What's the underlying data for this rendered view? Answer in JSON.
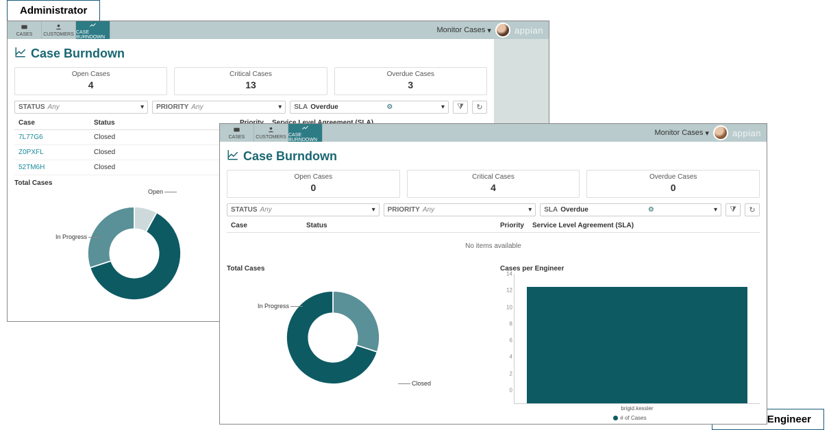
{
  "roles": {
    "admin": "Administrator",
    "engineer": "Support Engineer"
  },
  "nav": {
    "cases": "CASES",
    "customers": "CUSTOMERS",
    "burndown": "CASE BURNDOWN",
    "monitor": "Monitor Cases",
    "logo": "appian"
  },
  "admin": {
    "page_title": "Case Burndown",
    "stats": [
      {
        "label": "Open Cases",
        "value": "4"
      },
      {
        "label": "Critical Cases",
        "value": "13"
      },
      {
        "label": "Overdue Cases",
        "value": "3"
      }
    ],
    "filters": {
      "status_label": "STATUS",
      "status_value": "Any",
      "priority_label": "PRIORITY",
      "priority_value": "Any",
      "sla_label": "SLA",
      "sla_value": "Overdue"
    },
    "grid": {
      "cols": [
        "Case",
        "Status",
        "Priority",
        "Service Level Agreement (SLA)"
      ],
      "rows": [
        {
          "case": "7L77G6",
          "status": "Closed"
        },
        {
          "case": "Z0PXFL",
          "status": "Closed"
        },
        {
          "case": "52TM6H",
          "status": "Closed"
        }
      ]
    },
    "chart_title": "Total Cases",
    "seg_labels": {
      "open": "Open",
      "inprog": "In Progress"
    }
  },
  "eng": {
    "page_title": "Case Burndown",
    "stats": [
      {
        "label": "Open Cases",
        "value": "0"
      },
      {
        "label": "Critical Cases",
        "value": "4"
      },
      {
        "label": "Overdue Cases",
        "value": "0"
      }
    ],
    "filters": {
      "status_label": "STATUS",
      "status_value": "Any",
      "priority_label": "PRIORITY",
      "priority_value": "Any",
      "sla_label": "SLA",
      "sla_value": "Overdue"
    },
    "grid": {
      "cols": [
        "Case",
        "Status",
        "Priority",
        "Service Level Agreement (SLA)"
      ],
      "no_items": "No items available"
    },
    "chart_title": "Total Cases",
    "seg_labels": {
      "inprog": "In Progress",
      "closed": "Closed"
    },
    "bar_title": "Cases per Engineer",
    "bar_xlabel": "brigid.kessler",
    "bar_legend": "# of Cases"
  },
  "chart_data": [
    {
      "type": "pie",
      "title": "Total Cases (Administrator)",
      "slices": [
        {
          "name": "Open",
          "value": 8,
          "color": "#cdd9da"
        },
        {
          "name": "Closed",
          "value": 62,
          "color": "#0d5a63"
        },
        {
          "name": "In Progress",
          "value": 30,
          "color": "#5a9098"
        }
      ]
    },
    {
      "type": "pie",
      "title": "Total Cases (Support Engineer)",
      "slices": [
        {
          "name": "In Progress",
          "value": 30,
          "color": "#5a9098"
        },
        {
          "name": "Closed",
          "value": 70,
          "color": "#0d5a63"
        }
      ]
    },
    {
      "type": "bar",
      "title": "Cases per Engineer",
      "categories": [
        "brigid.kessler"
      ],
      "series": [
        {
          "name": "# of Cases",
          "values": [
            14
          ]
        }
      ],
      "ylabel": "",
      "ylim": [
        0,
        14
      ],
      "yticks": [
        0,
        2,
        4,
        6,
        8,
        10,
        12,
        14
      ]
    }
  ]
}
